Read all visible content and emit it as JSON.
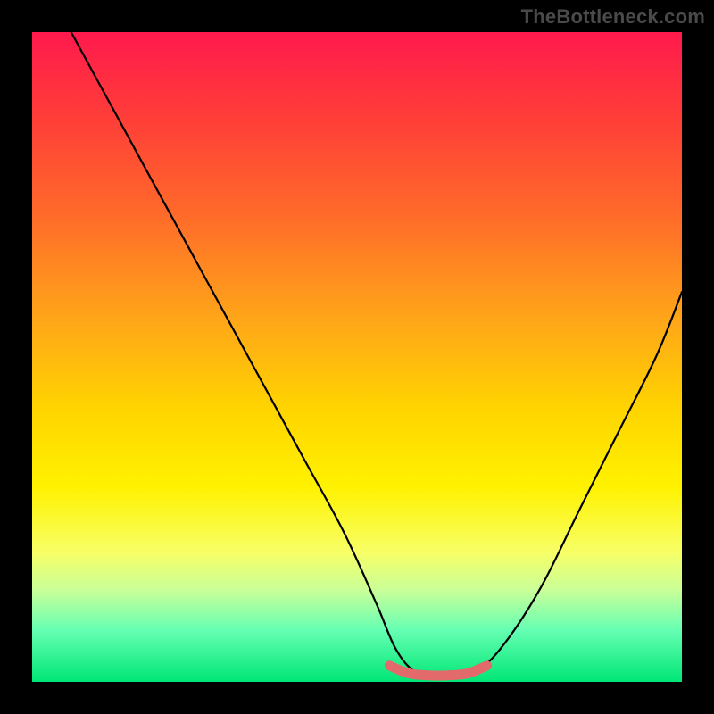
{
  "watermark": "TheBottleneck.com",
  "chart_data": {
    "type": "line",
    "title": "",
    "xlabel": "",
    "ylabel": "",
    "xlim": [
      0,
      100
    ],
    "ylim": [
      0,
      100
    ],
    "grid": false,
    "legend": false,
    "series": [
      {
        "name": "curve",
        "x": [
          6,
          12,
          18,
          24,
          30,
          36,
          42,
          48,
          53,
          56,
          59,
          62,
          65,
          68,
          72,
          78,
          84,
          90,
          96,
          100
        ],
        "y": [
          100,
          89,
          78,
          67,
          56,
          45,
          34,
          23,
          12,
          5,
          1.5,
          1,
          1,
          1.5,
          5,
          14,
          26,
          38,
          50,
          60
        ]
      }
    ],
    "highlight": {
      "name": "flat-segment",
      "x": [
        55,
        58,
        61,
        64,
        67,
        70
      ],
      "y": [
        2.5,
        1.3,
        1,
        1,
        1.3,
        2.5
      ]
    }
  }
}
